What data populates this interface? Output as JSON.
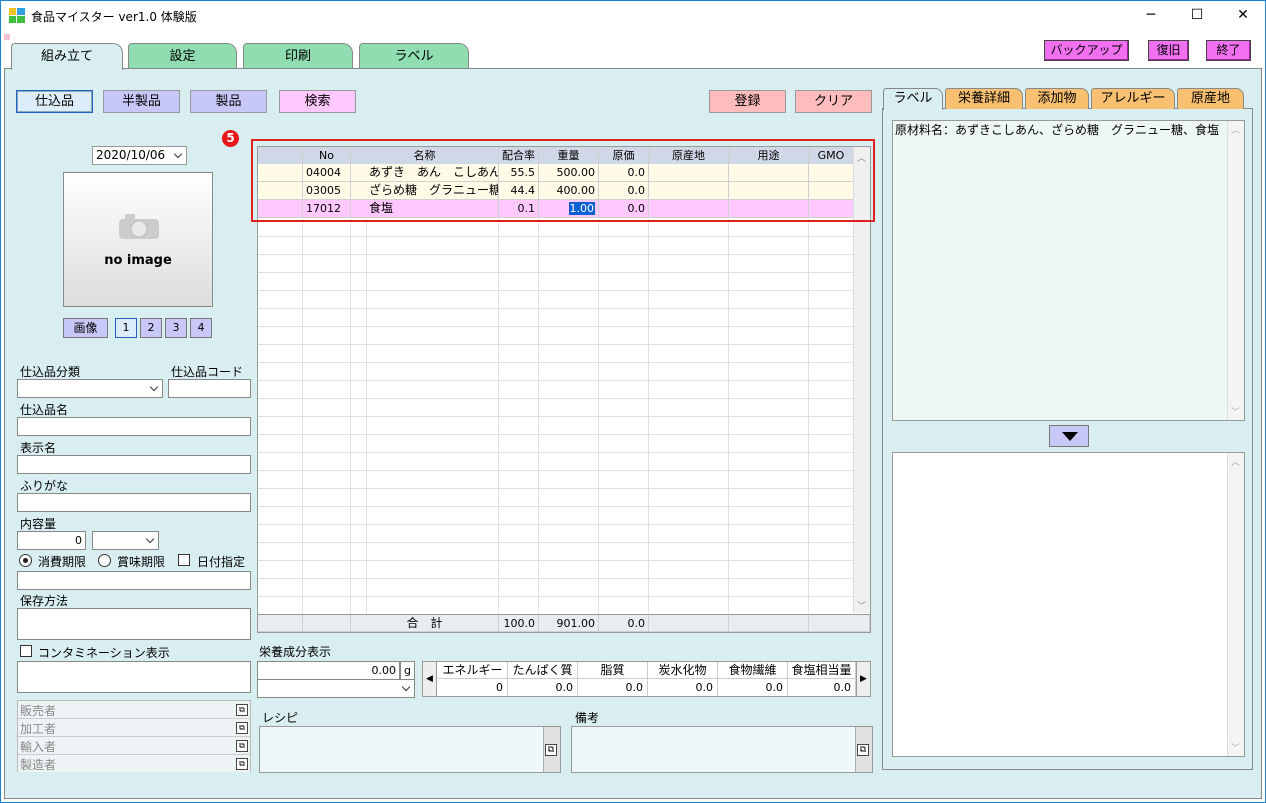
{
  "window": {
    "title": "食品マイスター ver1.0 体験版",
    "minimize": "─",
    "maximize": "☐",
    "close": "✕"
  },
  "tabs": [
    "組み立て",
    "設定",
    "印刷",
    "ラベル"
  ],
  "top_buttons": {
    "backup": "バックアップ",
    "restore": "復旧",
    "exit": "終了"
  },
  "mode_buttons": [
    "仕込品",
    "半製品",
    "製品",
    "検索"
  ],
  "actions": {
    "register": "登録",
    "clear": "クリア"
  },
  "date": "2020/10/06",
  "image": {
    "placeholder": "no image",
    "button": "画像",
    "pages": [
      "1",
      "2",
      "3",
      "4"
    ]
  },
  "form": {
    "category_label": "仕込品分類",
    "code_label": "仕込品コード",
    "name_label": "仕込品名",
    "display_label": "表示名",
    "kana_label": "ふりがな",
    "content_label": "内容量",
    "content_value": "0",
    "radio1": "消費期限",
    "radio2": "賞味期限",
    "check_date": "日付指定",
    "storage_label": "保存方法",
    "contamination_label": "コンタミネーション表示",
    "roles": [
      "販売者",
      "加工者",
      "輸入者",
      "製造者"
    ]
  },
  "marker": "5",
  "grid": {
    "headers": [
      "No",
      "名称",
      "配合率",
      "重量",
      "原価",
      "原産地",
      "用途",
      "GMO"
    ],
    "rows": [
      {
        "no": "04004",
        "name": "あずき　あん　こしあん",
        "ratio": "55.5",
        "weight": "500.00",
        "cost": "0.0"
      },
      {
        "no": "03005",
        "name": "ざらめ糖　グラニュー糖",
        "ratio": "44.4",
        "weight": "400.00",
        "cost": "0.0"
      },
      {
        "no": "17012",
        "name": "食塩",
        "ratio": "0.1",
        "weight": "1.00",
        "cost": "0.0"
      }
    ],
    "total_label": "合　計",
    "total_ratio": "100.0",
    "total_weight": "901.00",
    "total_cost": "0.0"
  },
  "nutrition": {
    "label": "栄養成分表示",
    "amount": "0.00",
    "unit": "g",
    "headers": [
      "エネルギー",
      "たんぱく質",
      "脂質",
      "炭水化物",
      "食物繊維",
      "食塩相当量"
    ],
    "values": [
      "0",
      "0.0",
      "0.0",
      "0.0",
      "0.0",
      "0.0"
    ]
  },
  "recipe_label": "レシピ",
  "notes_label": "備考",
  "right_tabs": [
    "ラベル",
    "栄養詳細",
    "添加物",
    "アレルギー",
    "原産地"
  ],
  "label_text": "原材料名：あずきこしあん、ざらめ糖　グラニュー糖、食塩",
  "colors": {
    "accent": "#1883d7",
    "panel": "#d8eef0",
    "tab_green": "#90ddb1",
    "highlight_row": "#ffc8ff"
  }
}
